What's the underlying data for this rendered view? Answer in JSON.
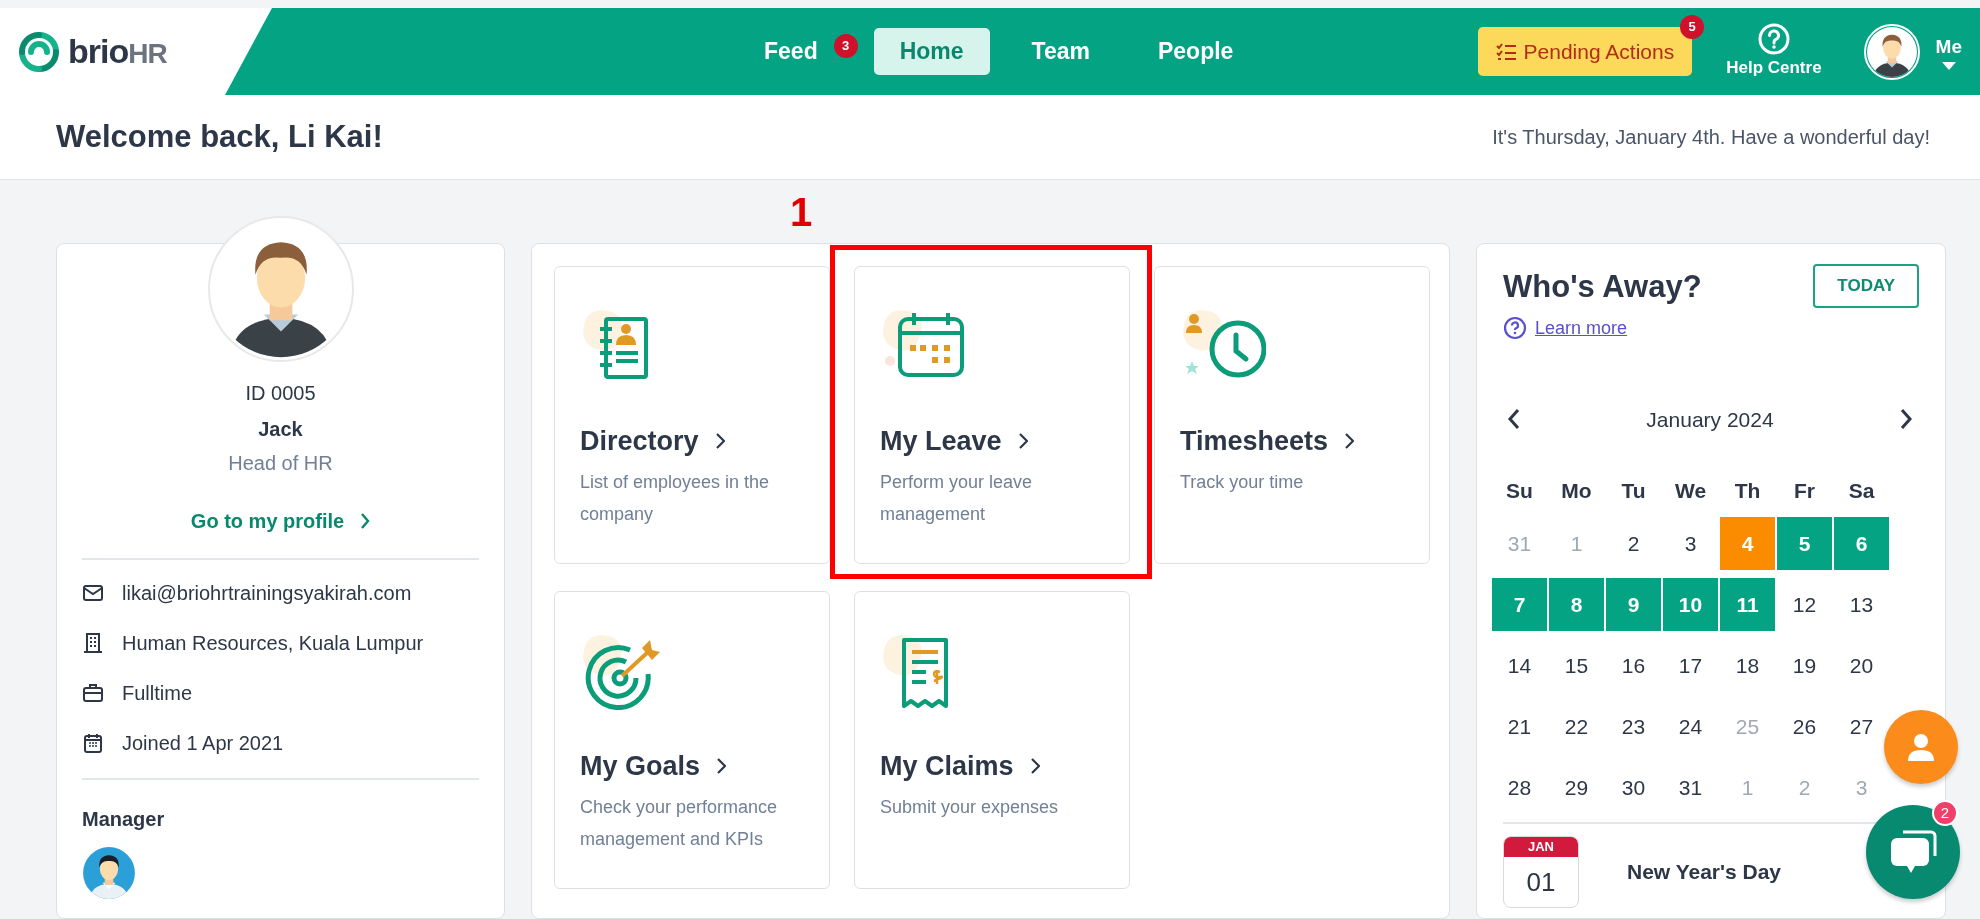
{
  "header": {
    "logo": {
      "name": "brio",
      "suffix": "HR"
    },
    "nav": [
      {
        "label": "Feed",
        "selected": false,
        "badge": "3"
      },
      {
        "label": "Home",
        "selected": true
      },
      {
        "label": "Team",
        "selected": false
      },
      {
        "label": "People",
        "selected": false
      }
    ],
    "pending": {
      "label": "Pending Actions",
      "badge": "5"
    },
    "help": {
      "label": "Help Centre"
    },
    "user": {
      "label": "Me"
    }
  },
  "welcome": {
    "title": "Welcome back, Li Kai!",
    "message": "It's Thursday, January 4th. Have a wonderful day!"
  },
  "profile": {
    "id": "ID 0005",
    "name": "Jack",
    "role": "Head of HR",
    "link": "Go to my profile",
    "details": [
      {
        "kind": "email",
        "text": "likai@briohrtrainingsyakirah.com"
      },
      {
        "kind": "office",
        "text": "Human Resources, Kuala Lumpur"
      },
      {
        "kind": "employment",
        "text": "Fulltime"
      },
      {
        "kind": "joined",
        "text": "Joined 1 Apr 2021"
      }
    ],
    "manager_label": "Manager"
  },
  "tiles": [
    {
      "kind": "directory",
      "title": "Directory",
      "description": "List of employees in the company",
      "highlighted": false
    },
    {
      "kind": "leave",
      "title": "My Leave",
      "description": "Perform your leave management",
      "highlighted": true
    },
    {
      "kind": "timesheets",
      "title": "Timesheets",
      "description": "Track your time",
      "highlighted": false
    },
    {
      "kind": "goals",
      "title": "My Goals",
      "description": "Check your performance management and KPIs",
      "highlighted": false
    },
    {
      "kind": "claims",
      "title": "My Claims",
      "description": "Submit your expenses",
      "highlighted": false
    }
  ],
  "annotation": {
    "label": "1"
  },
  "whos_away": {
    "title": "Who's Away?",
    "today_button": "TODAY",
    "learn_more": "Learn more",
    "month": "January 2024",
    "weekdays": [
      "Su",
      "Mo",
      "Tu",
      "We",
      "Th",
      "Fr",
      "Sa"
    ],
    "weeks": [
      [
        {
          "day": "31",
          "kind": "other"
        },
        {
          "day": "1",
          "kind": "other"
        },
        {
          "day": "2",
          "kind": "normal"
        },
        {
          "day": "3",
          "kind": "normal"
        },
        {
          "day": "4",
          "kind": "today"
        },
        {
          "day": "5",
          "kind": "away"
        },
        {
          "day": "6",
          "kind": "away"
        }
      ],
      [
        {
          "day": "7",
          "kind": "away"
        },
        {
          "day": "8",
          "kind": "away"
        },
        {
          "day": "9",
          "kind": "away"
        },
        {
          "day": "10",
          "kind": "away"
        },
        {
          "day": "11",
          "kind": "away"
        },
        {
          "day": "12",
          "kind": "normal"
        },
        {
          "day": "13",
          "kind": "normal"
        }
      ],
      [
        {
          "day": "14",
          "kind": "normal"
        },
        {
          "day": "15",
          "kind": "normal"
        },
        {
          "day": "16",
          "kind": "normal"
        },
        {
          "day": "17",
          "kind": "normal"
        },
        {
          "day": "18",
          "kind": "normal"
        },
        {
          "day": "19",
          "kind": "normal"
        },
        {
          "day": "20",
          "kind": "normal"
        }
      ],
      [
        {
          "day": "21",
          "kind": "normal"
        },
        {
          "day": "22",
          "kind": "normal"
        },
        {
          "day": "23",
          "kind": "normal"
        },
        {
          "day": "24",
          "kind": "normal"
        },
        {
          "day": "25",
          "kind": "other"
        },
        {
          "day": "26",
          "kind": "normal"
        },
        {
          "day": "27",
          "kind": "normal"
        }
      ],
      [
        {
          "day": "28",
          "kind": "normal"
        },
        {
          "day": "29",
          "kind": "normal"
        },
        {
          "day": "30",
          "kind": "normal"
        },
        {
          "day": "31",
          "kind": "normal"
        },
        {
          "day": "1",
          "kind": "other"
        },
        {
          "day": "2",
          "kind": "other"
        },
        {
          "day": "3",
          "kind": "other"
        }
      ]
    ],
    "holidays": [
      {
        "month": "JAN",
        "day": "01",
        "name": "New Year's Day"
      }
    ]
  },
  "chat": {
    "badge": "2"
  }
}
